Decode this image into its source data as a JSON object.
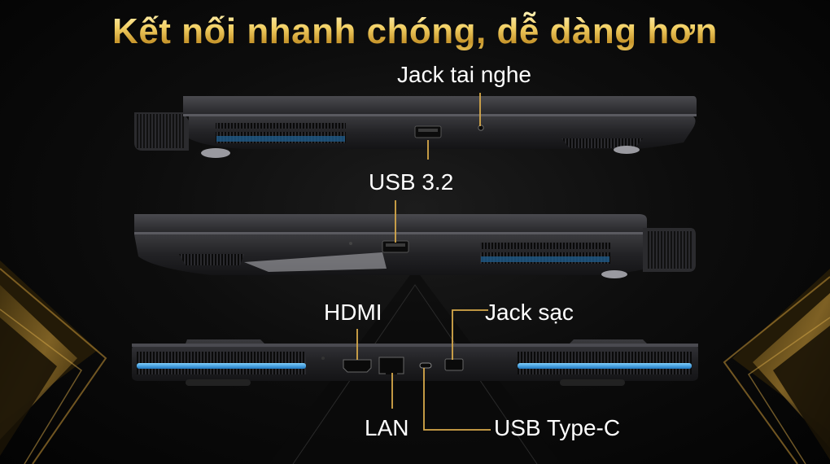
{
  "title": "Kết nối nhanh chóng, dễ dàng hơn",
  "labels": {
    "headphone_jack": "Jack tai nghe",
    "usb32": "USB 3.2",
    "hdmi": "HDMI",
    "charging_jack": "Jack sạc",
    "lan": "LAN",
    "usb_type_c": "USB Type-C"
  },
  "colors": {
    "title_gold": "#f2cf63",
    "leader_line": "#d7a94a",
    "vent_blue": "#3aa8e8",
    "background": "#050505"
  }
}
